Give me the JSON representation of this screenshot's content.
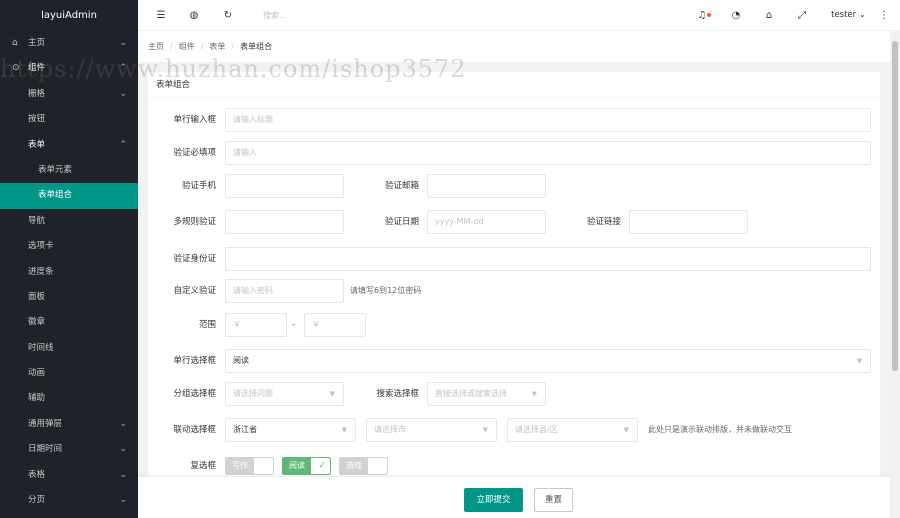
{
  "app": {
    "logo": "layuiAdmin"
  },
  "sidebar": {
    "items": [
      {
        "label": "主页",
        "icon": "home-icon",
        "arrow": "chevron-down-icon"
      },
      {
        "label": "组件",
        "icon": "component-icon",
        "arrow": "chevron-up-icon"
      },
      {
        "label": "栅格",
        "arrow": "chevron-down-icon"
      },
      {
        "label": "按钮"
      },
      {
        "label": "表单",
        "arrow": "chevron-up-icon"
      },
      {
        "label": "表单元素"
      },
      {
        "label": "表单组合"
      },
      {
        "label": "导航"
      },
      {
        "label": "选项卡"
      },
      {
        "label": "进度条"
      },
      {
        "label": "面板"
      },
      {
        "label": "徽章"
      },
      {
        "label": "时间线"
      },
      {
        "label": "动画"
      },
      {
        "label": "辅助"
      },
      {
        "label": "通用弹层",
        "arrow": "chevron-down-icon"
      },
      {
        "label": "日期时间",
        "arrow": "chevron-down-icon"
      },
      {
        "label": "表格",
        "arrow": "chevron-down-icon"
      },
      {
        "label": "分页",
        "arrow": "chevron-down-icon"
      }
    ]
  },
  "header": {
    "search_placeholder": "搜索...",
    "user": "tester",
    "icons": [
      "menu-toggle-icon",
      "website-icon",
      "refresh-icon",
      "bell-icon",
      "theme-icon",
      "tag-icon",
      "fullscreen-icon",
      "more-icon"
    ],
    "notify_color": "#ff5722"
  },
  "breadcrumb": [
    "主页",
    "组件",
    "表单",
    "表单组合"
  ],
  "card": {
    "title": "表单组合",
    "rows": {
      "single_line": {
        "label": "单行输入框",
        "placeholder": "请输入标题"
      },
      "required": {
        "label": "验证必填项",
        "placeholder": "请输入"
      },
      "phone": {
        "label": "验证手机"
      },
      "email": {
        "label": "验证邮箱"
      },
      "multi_rule": {
        "label": "多规则验证"
      },
      "date": {
        "label": "验证日期",
        "placeholder": "yyyy-MM-dd"
      },
      "link": {
        "label": "验证链接"
      },
      "id_card": {
        "label": "验证身份证"
      },
      "custom": {
        "label": "自定义验证",
        "placeholder": "请输入密码",
        "hint": "请填写6到12位密码"
      },
      "range": {
        "label": "范围",
        "min_placeholder": "￥",
        "max_placeholder": "￥",
        "sep": "-"
      },
      "select": {
        "label": "单行选择框",
        "value": "阅读"
      },
      "group_select": {
        "label": "分组选择框",
        "placeholder": "请选择问题"
      },
      "search_select": {
        "label": "搜索选择框",
        "placeholder": "直接选择或搜索选择"
      },
      "linked": {
        "label": "联动选择框",
        "province": "浙江省",
        "city_placeholder": "请选择市",
        "county_placeholder": "请选择县/区",
        "hint": "此处只是演示联动排版，并未做联动交互"
      },
      "checkbox": {
        "label": "复选框",
        "options": [
          {
            "text": "写作",
            "checked": false
          },
          {
            "text": "阅读",
            "checked": true
          },
          {
            "text": "游戏",
            "checked": false
          }
        ]
      }
    }
  },
  "footer": {
    "submit": "立即提交",
    "reset": "重置"
  },
  "watermark": "https://www.huzhan.com/ishop3572",
  "colors": {
    "accent": "#009688",
    "sidebar_bg": "#20222a",
    "checked_green": "#5fb878"
  }
}
